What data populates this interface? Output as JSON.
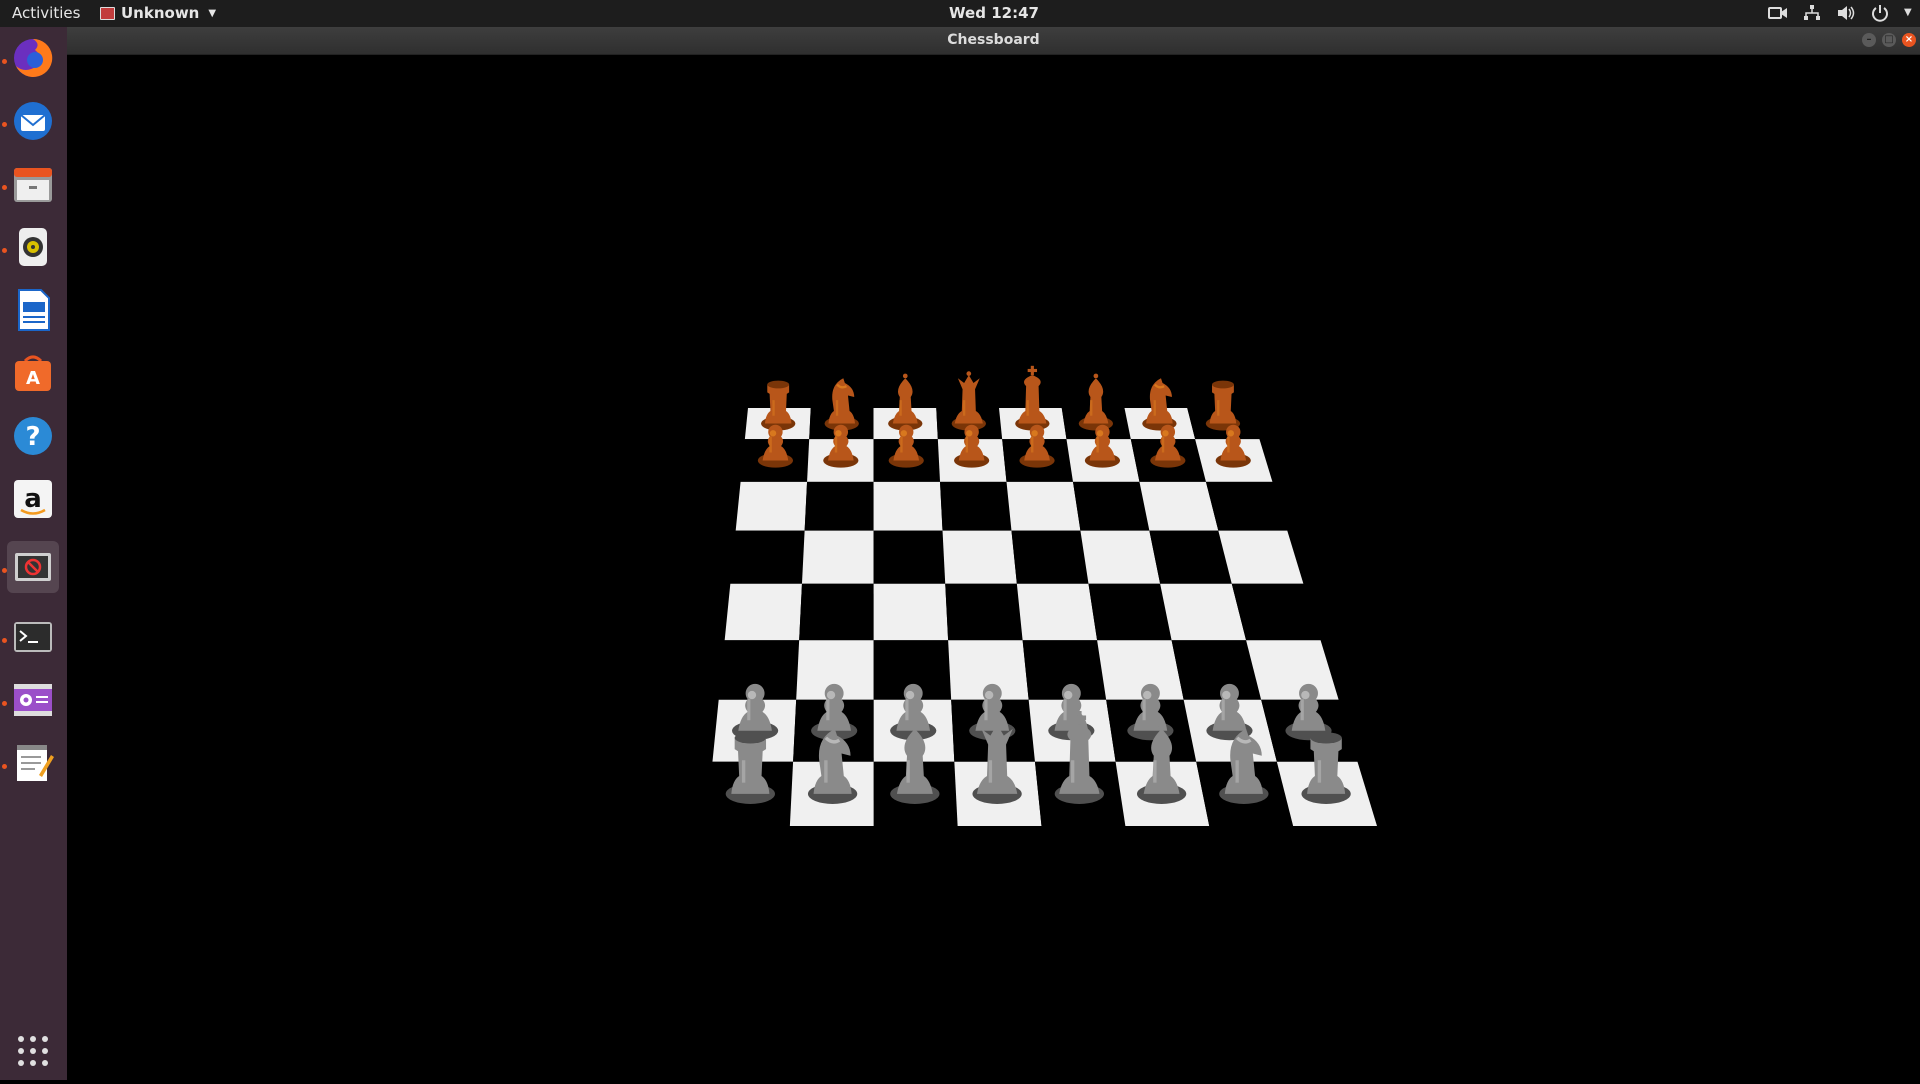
{
  "topbar": {
    "activities": "Activities",
    "app_name": "Unknown",
    "clock": "Wed 12:47"
  },
  "window": {
    "title": "Chessboard"
  },
  "dock": {
    "items": [
      {
        "name": "firefox-icon",
        "running": true
      },
      {
        "name": "thunderbird-icon",
        "running": true
      },
      {
        "name": "files-icon",
        "running": true
      },
      {
        "name": "rhythmbox-icon",
        "running": true
      },
      {
        "name": "libreoffice-writer-icon",
        "running": false
      },
      {
        "name": "software-center-icon",
        "running": false
      },
      {
        "name": "help-icon",
        "running": false
      },
      {
        "name": "amazon-icon",
        "running": false
      },
      {
        "name": "chessboard-app-icon",
        "running": true,
        "active": true
      },
      {
        "name": "terminal-icon",
        "running": true
      },
      {
        "name": "video-icon",
        "running": true
      },
      {
        "name": "text-editor-icon",
        "running": true
      }
    ],
    "show_apps_icon": "grid-icon"
  },
  "board": {
    "light_square": "#f0f0f0",
    "dark_square": "#000000",
    "black_pieces_color": "#b8561a",
    "white_pieces_color": "#8a8a8a",
    "back_rank": [
      "rook",
      "knight",
      "bishop",
      "queen",
      "king",
      "bishop",
      "knight",
      "rook"
    ]
  }
}
